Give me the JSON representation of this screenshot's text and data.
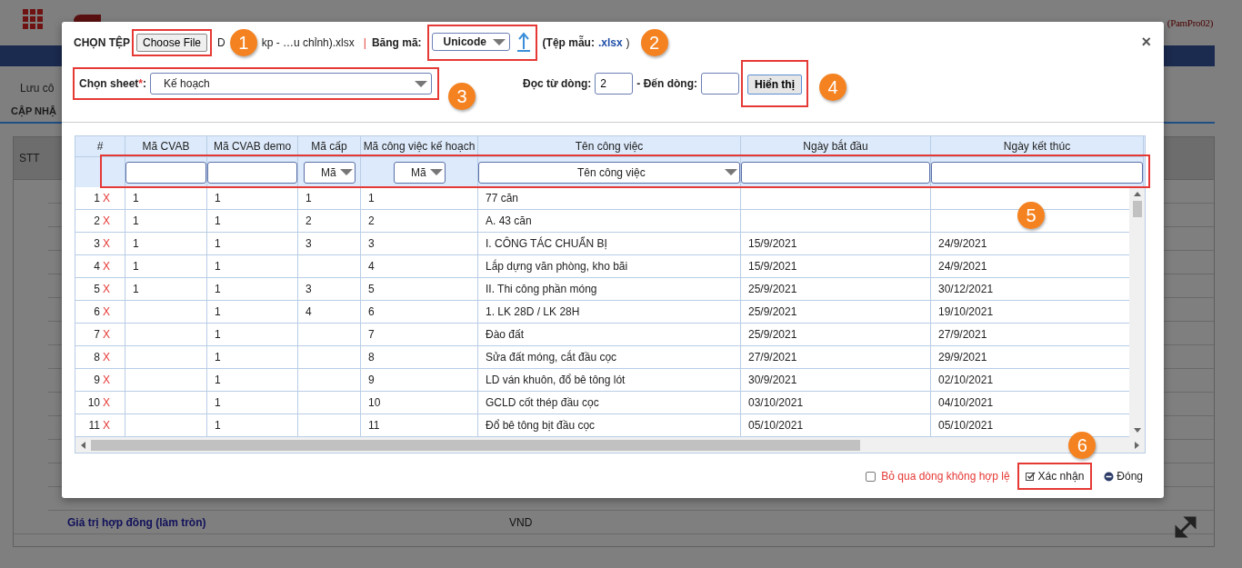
{
  "backdrop": {
    "account": "(PamPro02)",
    "toolbar_label": "Lưu cô",
    "section_title": "CẬP NHẬ",
    "table_header": "STT",
    "row_label": "Giá trị hợp đồng (làm tròn)",
    "row_unit": "VND"
  },
  "dialog": {
    "file_label": "CHỌN TỆP",
    "choose_button": "Choose File",
    "file_name_start": "D",
    "file_name": "kp - …u chỉnh).xlsx",
    "separator": "|",
    "encoding_label": "Băng mã:",
    "encoding": "Unicode",
    "template_prefix": "(Tệp mẫu:",
    "template_link": ".xlsx",
    "template_suffix": ")",
    "close": "×",
    "sheet_label": "Chọn sheet",
    "required_mark": "*",
    "sheet_colon": ":",
    "sheet": "Kế hoạch",
    "from_label": "Đọc từ dòng:",
    "from_value": "2",
    "to_label": "- Đến dòng:",
    "show_button": "Hiển thị"
  },
  "table": {
    "index_header": "#",
    "columns": [
      {
        "label": "Mã CVAB",
        "filter": {
          "kind": "text"
        }
      },
      {
        "label": "Mã CVAB demo",
        "filter": {
          "kind": "text"
        }
      },
      {
        "label": "Mã cấp",
        "filter": {
          "kind": "select",
          "value": "Mã"
        }
      },
      {
        "label": "Mã công việc kế hoạch",
        "filter": {
          "kind": "select",
          "value": "Mã"
        }
      },
      {
        "label": "Tên công việc",
        "filter": {
          "kind": "select",
          "value": "Tên công việc"
        }
      },
      {
        "label": "Ngày bắt đầu",
        "filter": {
          "kind": "text"
        }
      },
      {
        "label": "Ngày kết thúc",
        "filter": {
          "kind": "text"
        }
      }
    ],
    "rows": [
      {
        "index": "1",
        "delete": "X",
        "cells": [
          "1",
          "1",
          "1",
          "1",
          "77 căn",
          null,
          null
        ]
      },
      {
        "index": "2",
        "delete": "X",
        "cells": [
          "1",
          "1",
          "2",
          "2",
          "A. 43 căn",
          null,
          null
        ]
      },
      {
        "index": "3",
        "delete": "X",
        "cells": [
          "1",
          "1",
          "3",
          "3",
          "I. CÔNG TÁC CHUẨN BỊ",
          "15/9/2021",
          "24/9/2021"
        ]
      },
      {
        "index": "4",
        "delete": "X",
        "cells": [
          "1",
          "1",
          null,
          "4",
          "Lắp dựng văn phòng, kho bãi",
          "15/9/2021",
          "24/9/2021"
        ]
      },
      {
        "index": "5",
        "delete": "X",
        "cells": [
          "1",
          "1",
          "3",
          "5",
          "II. Thi công phần móng",
          "25/9/2021",
          "30/12/2021"
        ]
      },
      {
        "index": "6",
        "delete": "X",
        "cells": [
          null,
          "1",
          "4",
          "6",
          "1. LK 28D / LK 28H",
          "25/9/2021",
          "19/10/2021"
        ]
      },
      {
        "index": "7",
        "delete": "X",
        "cells": [
          null,
          "1",
          null,
          "7",
          "Đào đất",
          "25/9/2021",
          "27/9/2021"
        ]
      },
      {
        "index": "8",
        "delete": "X",
        "cells": [
          null,
          "1",
          null,
          "8",
          "Sửa đất móng, cắt đầu cọc",
          "27/9/2021",
          "29/9/2021"
        ]
      },
      {
        "index": "9",
        "delete": "X",
        "cells": [
          null,
          "1",
          null,
          "9",
          "LD ván khuôn, đổ bê tông lót",
          "30/9/2021",
          "02/10/2021"
        ]
      },
      {
        "index": "10",
        "delete": "X",
        "cells": [
          null,
          "1",
          null,
          "10",
          "GCLD cốt thép đầu cọc",
          "03/10/2021",
          "04/10/2021"
        ]
      },
      {
        "index": "11",
        "delete": "X",
        "cells": [
          null,
          "1",
          null,
          "11",
          "Đổ bê tông bịt đầu cọc",
          "05/10/2021",
          "05/10/2021"
        ]
      }
    ]
  },
  "footer": {
    "skip_invalid": {
      "label": "Bỏ qua dòng không hợp lệ",
      "checked": false
    },
    "confirm": "Xác nhận",
    "close": "Đóng"
  },
  "annotations": [
    {
      "number": "1"
    },
    {
      "number": "2"
    },
    {
      "number": "3"
    },
    {
      "number": "4"
    },
    {
      "number": "5"
    },
    {
      "number": "6"
    }
  ]
}
